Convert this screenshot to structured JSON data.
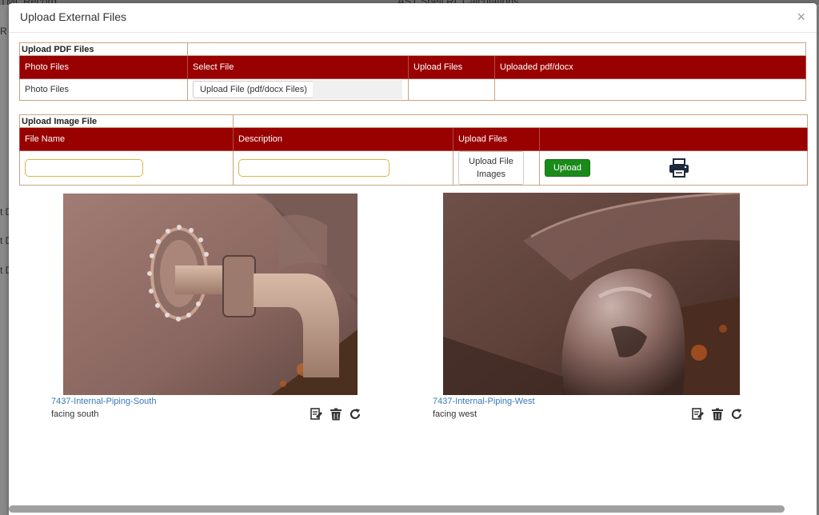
{
  "background": {
    "left_header": "TML Record",
    "right_header": "AST Shell RL Calculations",
    "side_labels": [
      "R",
      "t D",
      "t D",
      "t D"
    ]
  },
  "modal": {
    "title": "Upload External Files",
    "close_glyph": "×"
  },
  "pdf_section": {
    "title": "Upload PDF Files",
    "headers": [
      "Photo Files",
      "Select File",
      "Upload Files",
      "Uploaded pdf/docx"
    ],
    "row_label": "Photo Files",
    "select_button_label": "Upload File (pdf/docx Files)"
  },
  "image_section": {
    "title": "Upload Image File",
    "headers": [
      "File Name",
      "Description",
      "Upload Files",
      ""
    ],
    "file_name_value": "",
    "description_value": "",
    "upload_images_label_line1": "Upload File",
    "upload_images_label_line2": "Images",
    "upload_button_label": "Upload"
  },
  "photos": [
    {
      "title": "7437-Internal-Piping-South",
      "description": "facing south"
    },
    {
      "title": "7437-Internal-Piping-West",
      "description": "facing west"
    }
  ],
  "icons": {
    "print": "printer-icon",
    "edit": "edit-icon",
    "delete": "trash-icon",
    "rotate": "rotate-icon"
  },
  "colors": {
    "header_red": "#990000",
    "upload_green": "#1a8a1a",
    "link_blue": "#3a7ab8"
  }
}
